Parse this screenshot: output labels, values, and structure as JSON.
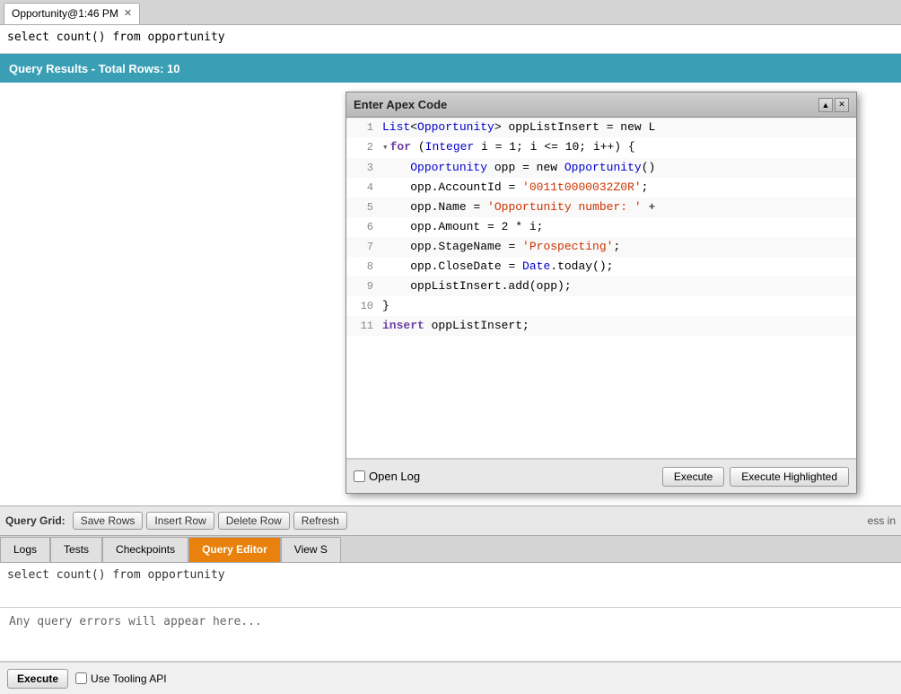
{
  "tab": {
    "label": "Opportunity@1:46 PM",
    "close_icon": "✕"
  },
  "query_bar": {
    "text": "select count() from opportunity"
  },
  "results_header": {
    "text": "Query Results - Total Rows: 10"
  },
  "query_grid_toolbar": {
    "label": "Query Grid:",
    "buttons": [
      "Save Rows",
      "Insert Row",
      "Delete Row",
      "Refresh"
    ],
    "extra": "ess in"
  },
  "bottom_tabs": {
    "tabs": [
      "Logs",
      "Tests",
      "Checkpoints",
      "Query Editor",
      "View S"
    ]
  },
  "query_editor": {
    "text": "select count() from opportunity"
  },
  "error_area": {
    "placeholder": "Any query errors will appear here..."
  },
  "execute_bar": {
    "execute_label": "Execute",
    "checkbox_label": "Use Tooling API"
  },
  "modal": {
    "title": "Enter Apex Code",
    "minimize_icon": "▲",
    "close_icon": "✕",
    "code_lines": [
      {
        "num": "1",
        "indent": "",
        "arrow": "",
        "content": "List<Opportunity> oppListInsert = new L"
      },
      {
        "num": "2",
        "indent": "",
        "arrow": "▾",
        "content": "for (Integer i = 1; i <= 10; i++) {"
      },
      {
        "num": "3",
        "indent": "    ",
        "arrow": "",
        "content": "Opportunity opp = new Opportunity()"
      },
      {
        "num": "4",
        "indent": "    ",
        "arrow": "",
        "content": "opp.AccountId = '0011t0000032Z0R';"
      },
      {
        "num": "5",
        "indent": "    ",
        "arrow": "",
        "content": "opp.Name = 'Opportunity number: ' +"
      },
      {
        "num": "6",
        "indent": "    ",
        "arrow": "",
        "content": "opp.Amount = 2 * i;"
      },
      {
        "num": "7",
        "indent": "    ",
        "arrow": "",
        "content": "opp.StageName = 'Prospecting';"
      },
      {
        "num": "8",
        "indent": "    ",
        "arrow": "",
        "content": "opp.CloseDate = Date.today();"
      },
      {
        "num": "9",
        "indent": "    ",
        "arrow": "",
        "content": "oppListInsert.add(opp);"
      },
      {
        "num": "10",
        "indent": "",
        "arrow": "",
        "content": "}"
      },
      {
        "num": "11",
        "indent": "",
        "arrow": "",
        "content": "insert oppListInsert;"
      }
    ],
    "footer": {
      "open_log_label": "Open Log",
      "execute_label": "Execute",
      "execute_highlighted_label": "Execute Highlighted"
    }
  }
}
